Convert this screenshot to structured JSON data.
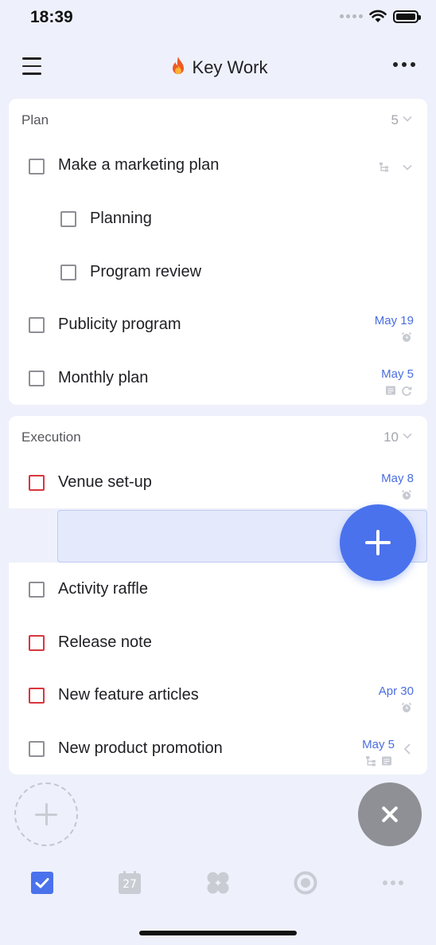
{
  "status_bar": {
    "time": "18:39"
  },
  "header": {
    "title": "Key Work",
    "title_icon": "fire-icon"
  },
  "groups": [
    {
      "title": "Plan",
      "count": "5",
      "tasks": [
        {
          "label": "Make a marketing plan",
          "indent": 0,
          "checkbox": "gray",
          "date": "",
          "icons": [
            "subtask-icon",
            "chevron-down-icon"
          ]
        },
        {
          "label": "Planning",
          "indent": 1,
          "checkbox": "gray",
          "date": "",
          "icons": []
        },
        {
          "label": "Program review",
          "indent": 1,
          "checkbox": "gray",
          "date": "",
          "icons": []
        },
        {
          "label": "Publicity program",
          "indent": 0,
          "checkbox": "gray",
          "date": "May 19",
          "icons": [
            "alarm-icon"
          ]
        },
        {
          "label": "Monthly plan",
          "indent": 0,
          "checkbox": "gray",
          "date": "May 5",
          "icons": [
            "note-icon",
            "repeat-icon"
          ]
        }
      ]
    },
    {
      "title": "Execution",
      "count": "10",
      "tasks": [
        {
          "label": "Venue set-up",
          "indent": 0,
          "checkbox": "red",
          "date": "May 8",
          "icons": [
            "alarm-icon"
          ]
        },
        {
          "label": "Activity raffle",
          "indent": 0,
          "checkbox": "gray",
          "date": "",
          "icons": []
        },
        {
          "label": "Release note",
          "indent": 0,
          "checkbox": "red",
          "date": "",
          "icons": []
        },
        {
          "label": "New feature articles",
          "indent": 0,
          "checkbox": "red",
          "date": "Apr 30",
          "icons": [
            "alarm-icon"
          ]
        },
        {
          "label": "New product promotion",
          "indent": 0,
          "checkbox": "gray",
          "date": "May 5",
          "icons": [
            "subtask-icon",
            "note-icon",
            "chevron-left-icon"
          ]
        }
      ]
    }
  ],
  "calendar_tab_day": "27",
  "colors": {
    "accent": "#4a72ec",
    "date_blue": "#4a6ee0",
    "overdue_red": "#d9363e",
    "background": "#eef1fb"
  },
  "tabs": [
    "tasks-tab-icon",
    "calendar-tab-icon",
    "apps-tab-icon",
    "focus-tab-icon",
    "more-tab-icon"
  ]
}
